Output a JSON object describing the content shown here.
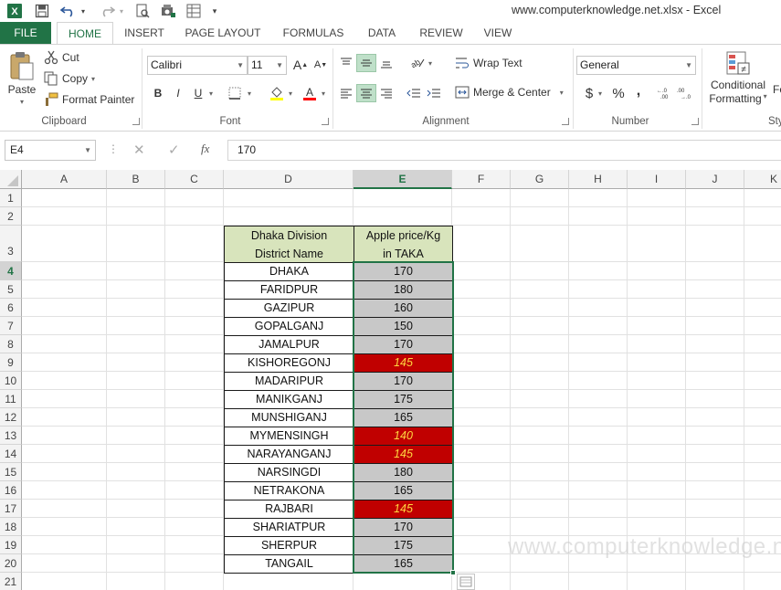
{
  "window": {
    "title": "www.computerknowledge.net.xlsx - Excel"
  },
  "quick_access": {
    "app_icon": "excel-logo-icon",
    "save_icon": "save-icon",
    "undo_icon": "undo-icon",
    "redo_icon": "redo-icon",
    "icons": [
      "print-preview-icon",
      "camera-icon",
      "form-icon",
      "customize-icon"
    ]
  },
  "tabs": [
    "FILE",
    "HOME",
    "INSERT",
    "PAGE LAYOUT",
    "FORMULAS",
    "DATA",
    "REVIEW",
    "VIEW"
  ],
  "ribbon": {
    "clipboard": {
      "paste": "Paste",
      "cut": "Cut",
      "copy": "Copy",
      "format_painter": "Format Painter",
      "label": "Clipboard"
    },
    "font": {
      "name": "Calibri",
      "size": "11",
      "bold": "B",
      "italic": "I",
      "underline": "U",
      "grow": "A",
      "shrink": "A",
      "label": "Font"
    },
    "alignment": {
      "wrap_text": "Wrap Text",
      "merge_center": "Merge & Center",
      "label": "Alignment"
    },
    "number": {
      "format": "General",
      "currency": "$",
      "percent": "%",
      "comma": ",",
      "label": "Number"
    },
    "styles": {
      "conditional": "Conditional",
      "formatting": "Formatting",
      "fo": "Fo",
      "sty": "Sty"
    }
  },
  "formula_bar": {
    "name_box": "E4",
    "fx": "fx",
    "value": "170"
  },
  "columns": [
    "A",
    "B",
    "C",
    "D",
    "E",
    "F",
    "G",
    "H",
    "I",
    "J",
    "K"
  ],
  "active_cell": {
    "column": "E",
    "row": "4"
  },
  "rows": [
    "1",
    "2",
    "3",
    "4",
    "5",
    "6",
    "7",
    "8",
    "9",
    "10",
    "11",
    "12",
    "13",
    "14",
    "15",
    "16",
    "17",
    "18",
    "19",
    "20",
    "21"
  ],
  "table": {
    "header_d_line1": "Dhaka Division",
    "header_d_line2": "District Name",
    "header_e_line1": "Apple price/Kg",
    "header_e_line2": "in TAKA",
    "highlight_color": "#c00000",
    "highlight_text_color": "#ffd740",
    "data_rows": [
      {
        "district": "DHAKA",
        "price": "170",
        "highlight": false
      },
      {
        "district": "FARIDPUR",
        "price": "180",
        "highlight": false
      },
      {
        "district": "GAZIPUR",
        "price": "160",
        "highlight": false
      },
      {
        "district": "GOPALGANJ",
        "price": "150",
        "highlight": false
      },
      {
        "district": "JAMALPUR",
        "price": "170",
        "highlight": false
      },
      {
        "district": "KISHOREGONJ",
        "price": "145",
        "highlight": true
      },
      {
        "district": "MADARIPUR",
        "price": "170",
        "highlight": false
      },
      {
        "district": "MANIKGANJ",
        "price": "175",
        "highlight": false
      },
      {
        "district": "MUNSHIGANJ",
        "price": "165",
        "highlight": false
      },
      {
        "district": "MYMENSINGH",
        "price": "140",
        "highlight": true
      },
      {
        "district": "NARAYANGANJ",
        "price": "145",
        "highlight": true
      },
      {
        "district": "NARSINGDI",
        "price": "180",
        "highlight": false
      },
      {
        "district": "NETRAKONA",
        "price": "165",
        "highlight": false
      },
      {
        "district": "RAJBARI",
        "price": "145",
        "highlight": true
      },
      {
        "district": "SHARIATPUR",
        "price": "170",
        "highlight": false
      },
      {
        "district": "SHERPUR",
        "price": "175",
        "highlight": false
      },
      {
        "district": "TANGAIL",
        "price": "165",
        "highlight": false
      }
    ]
  },
  "watermark": "www.computerknowledge.net"
}
